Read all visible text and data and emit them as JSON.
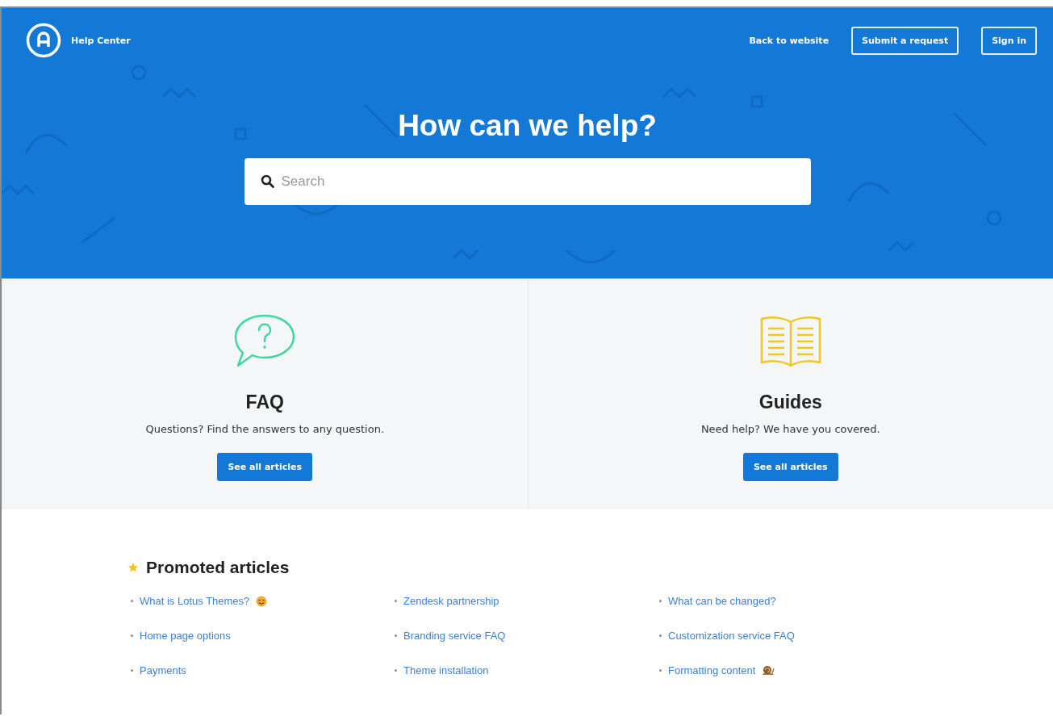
{
  "header": {
    "brand": "Help Center",
    "links": [
      {
        "label": "Back to website",
        "kind": "link"
      },
      {
        "label": "Submit a request",
        "kind": "outlined"
      },
      {
        "label": "Sign in",
        "kind": "outlined"
      }
    ]
  },
  "hero": {
    "title": "How can we help?",
    "search": {
      "placeholder": "Search"
    }
  },
  "categories": [
    {
      "kind": "faq",
      "title": "FAQ",
      "description": "Questions? Find the answers to any question.",
      "button": "See all articles"
    },
    {
      "kind": "guides",
      "title": "Guides",
      "description": "Need help? We have you covered.",
      "button": "See all articles"
    }
  ],
  "promoted": {
    "title": "Promoted articles",
    "articles": [
      {
        "label": "What is Lotus Themes?",
        "kind": "smiley"
      },
      {
        "label": "Zendesk partnership",
        "kind": "plain"
      },
      {
        "label": "What can be changed?",
        "kind": "plain"
      },
      {
        "label": "Home page options",
        "kind": "plain"
      },
      {
        "label": "Branding service FAQ",
        "kind": "plain"
      },
      {
        "label": "Customization service FAQ",
        "kind": "plain"
      },
      {
        "label": "Payments",
        "kind": "plain"
      },
      {
        "label": "Theme installation",
        "kind": "plain"
      },
      {
        "label": "Formatting content",
        "kind": "snail"
      }
    ]
  }
}
